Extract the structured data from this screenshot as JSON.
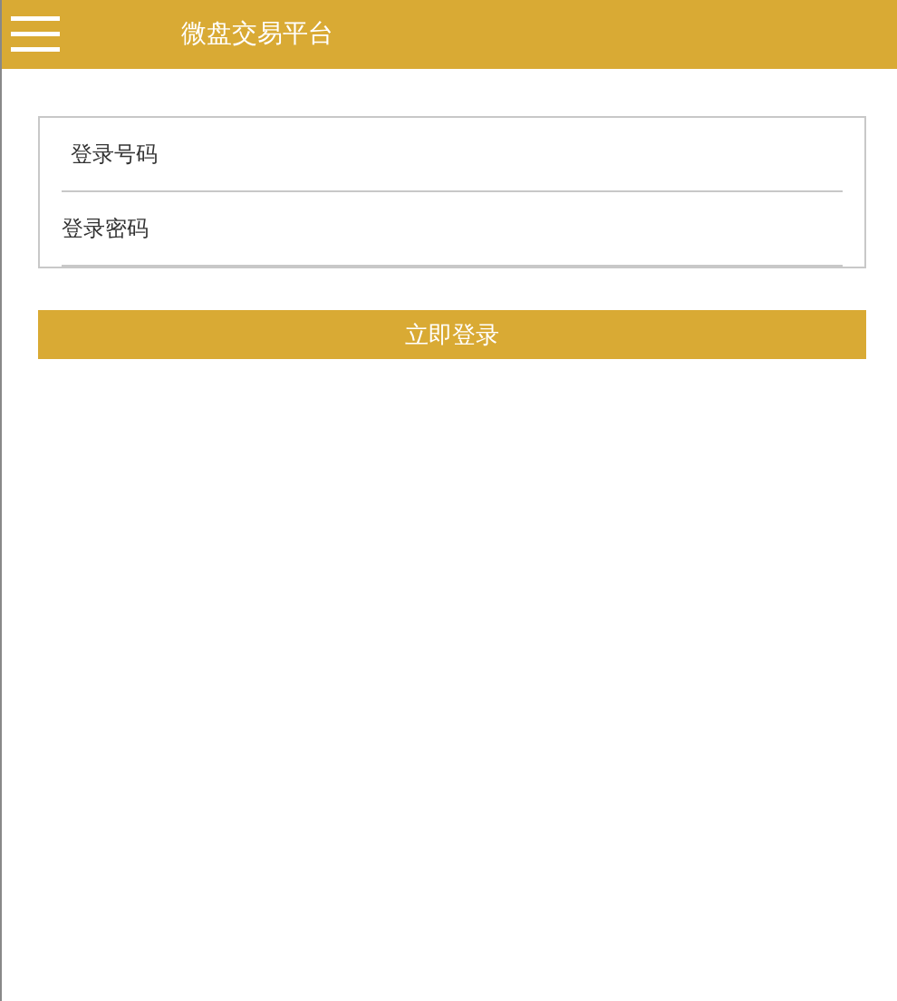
{
  "header": {
    "title": "微盘交易平台"
  },
  "login_form": {
    "fields": [
      {
        "kind": "text",
        "placeholder": "登录号码"
      },
      {
        "kind": "password",
        "placeholder": "登录密码"
      }
    ]
  },
  "submit_button": {
    "label": "立即登录"
  }
}
